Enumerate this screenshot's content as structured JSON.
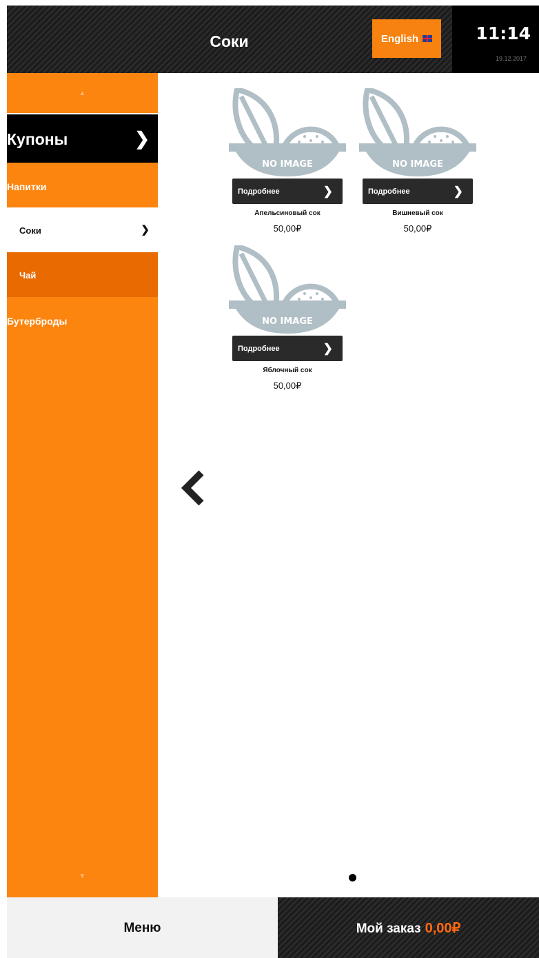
{
  "header": {
    "title": "Соки",
    "language_button": "English",
    "language_icon": "uk-flag-icon",
    "clock": "11:14",
    "date": "19.12.2017"
  },
  "sidebar": {
    "coupons_label": "Купоны",
    "categories": [
      {
        "label": "Напитки"
      },
      {
        "label": "Соки",
        "selected": true
      },
      {
        "label": "Чай"
      },
      {
        "label": "Бутерброды"
      }
    ]
  },
  "products": [
    {
      "image": "NO IMAGE",
      "details_label": "Подробнее",
      "name": "Апельсиновый сок",
      "price": "50,00₽"
    },
    {
      "image": "NO IMAGE",
      "details_label": "Подробнее",
      "name": "Вишневый сок",
      "price": "50,00₽"
    },
    {
      "image": "NO IMAGE",
      "details_label": "Подробнее",
      "name": "Яблочный сок",
      "price": "50,00₽"
    }
  ],
  "footer": {
    "menu_label": "Меню",
    "order_label": "Мой заказ",
    "order_total": "0,00₽"
  },
  "colors": {
    "accent": "#fb850f",
    "active_category": "#e86a00",
    "header_dark": "#1f1f1f",
    "total_highlight": "#ff6a13",
    "placeholder_gray": "#b0bec5"
  }
}
